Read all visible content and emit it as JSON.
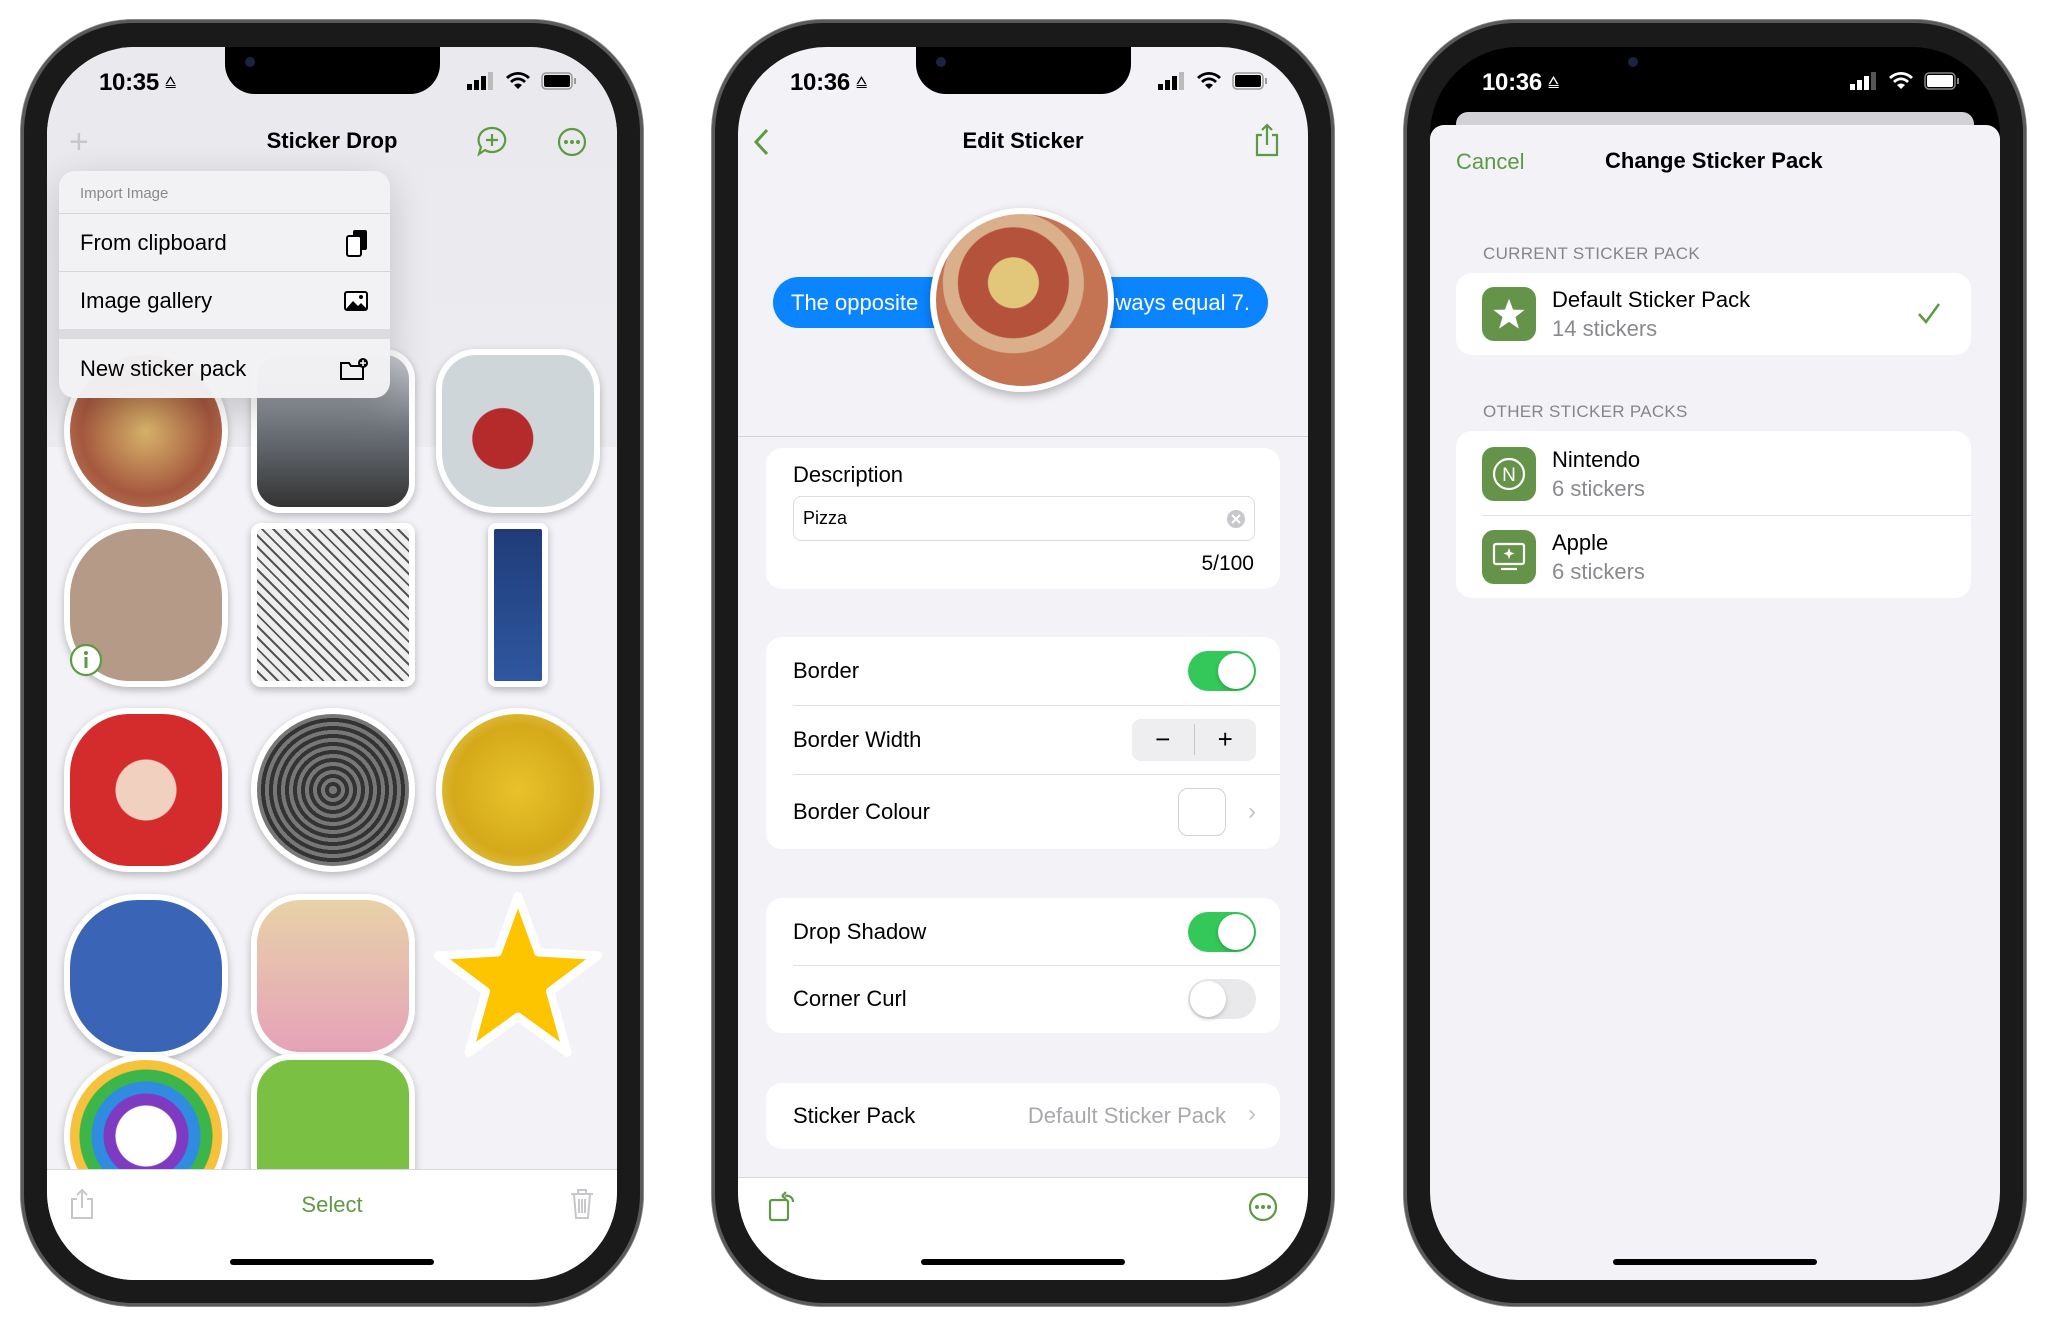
{
  "accent_color": "#5e9a44",
  "phone1": {
    "status": {
      "time": "10:35"
    },
    "nav": {
      "title": "Sticker Drop",
      "left_icon": "plus-icon",
      "right_icons": [
        "add-message-icon",
        "more-icon"
      ]
    },
    "menu": {
      "header": "Import Image",
      "items": [
        {
          "label": "From clipboard",
          "icon": "clipboard-icon"
        },
        {
          "label": "Image gallery",
          "icon": "photo-icon"
        },
        {
          "label": "New sticker pack",
          "icon": "folder-plus-icon"
        }
      ]
    },
    "stickers": [
      "pizza",
      "racing-car",
      "mug",
      "teddy-bear",
      "comic-panel",
      "radio-tower",
      "santa",
      "manhole-cover",
      "yellow-flowers",
      "blue-monster",
      "dancer",
      "star",
      "rainbow",
      "green-shape"
    ],
    "toolbar": {
      "select_label": "Select"
    }
  },
  "phone2": {
    "status": {
      "time": "10:36"
    },
    "nav": {
      "title": "Edit Sticker"
    },
    "preview": {
      "bubble_left": "The opposite",
      "bubble_right": "ways equal 7."
    },
    "description": {
      "label": "Description",
      "value": "Pizza",
      "counter": "5/100"
    },
    "border": {
      "label": "Border",
      "on": true,
      "width_label": "Border Width",
      "minus": "−",
      "plus": "+",
      "colour_label": "Border Colour",
      "colour": "#ffffff"
    },
    "effects": {
      "shadow_label": "Drop Shadow",
      "shadow_on": true,
      "curl_label": "Corner Curl",
      "curl_on": false
    },
    "pack": {
      "label": "Sticker Pack",
      "value": "Default Sticker Pack"
    }
  },
  "phone3": {
    "status": {
      "time": "10:36"
    },
    "nav": {
      "cancel": "Cancel",
      "title": "Change Sticker Pack"
    },
    "current_header": "CURRENT STICKER PACK",
    "current": {
      "name": "Default Sticker Pack",
      "count": "14 stickers",
      "icon": "star-icon",
      "selected": true
    },
    "other_header": "OTHER STICKER PACKS",
    "others": [
      {
        "name": "Nintendo",
        "count": "6 stickers",
        "icon": "n-circle-icon"
      },
      {
        "name": "Apple",
        "count": "6 stickers",
        "icon": "display-sparkle-icon"
      }
    ]
  }
}
